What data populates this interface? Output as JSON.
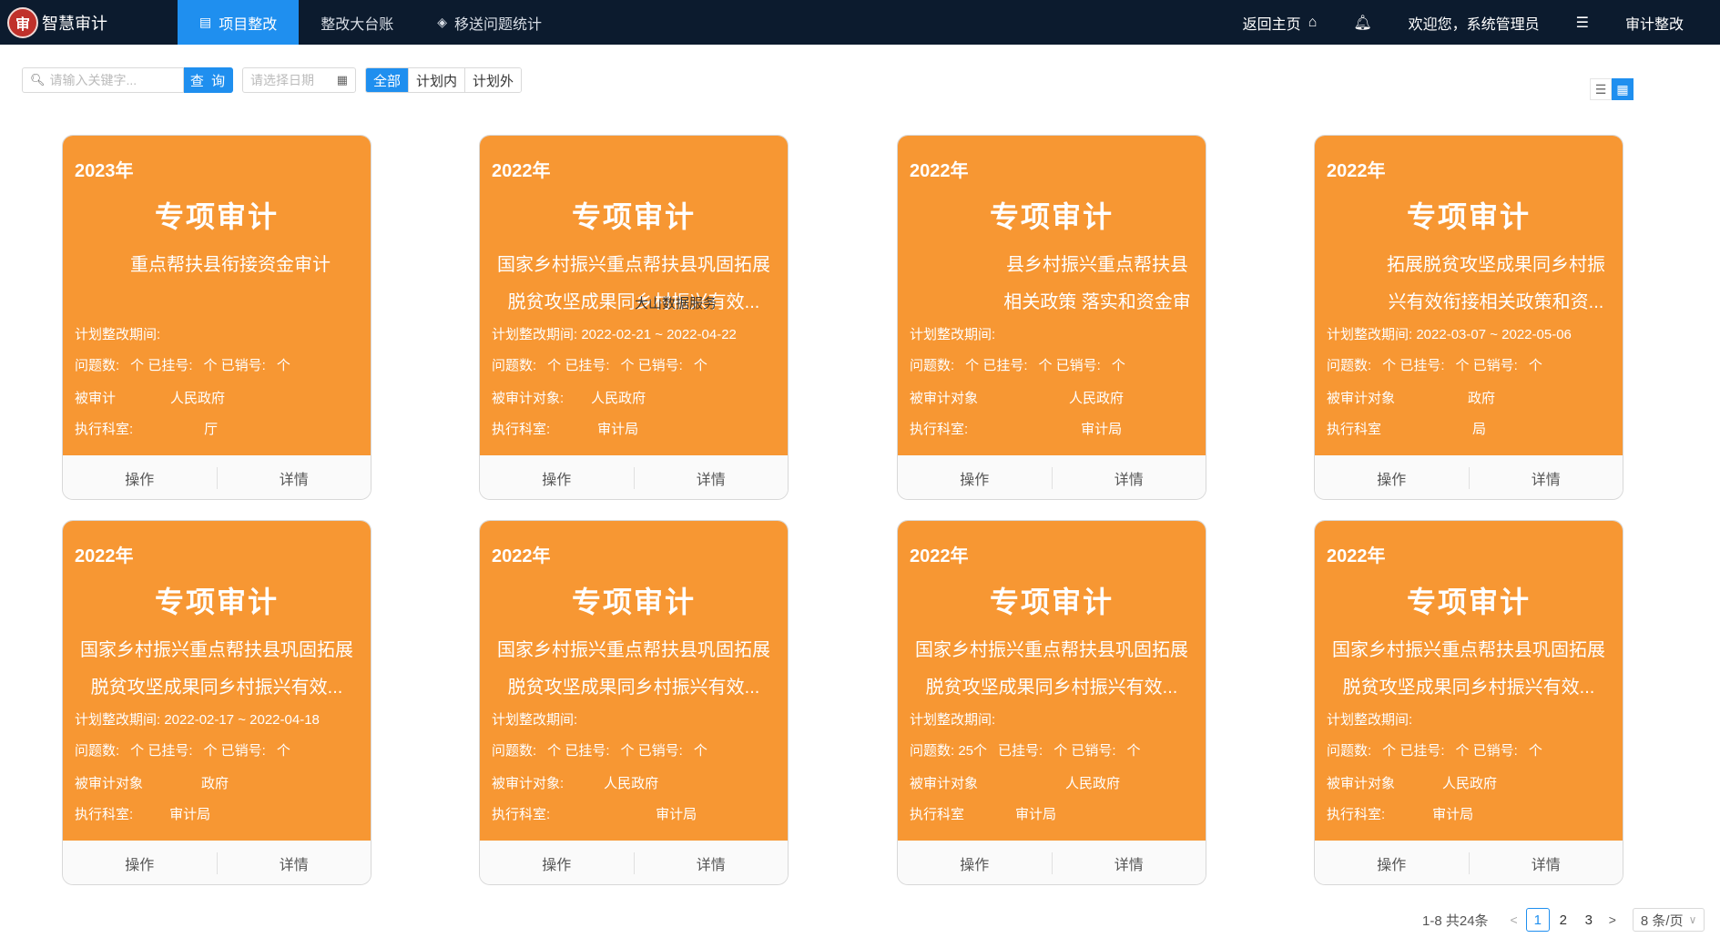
{
  "app": {
    "logo_text": "审",
    "title": "智慧审计"
  },
  "nav": {
    "tabs": [
      {
        "label": "项目整改",
        "icon": "document-icon"
      },
      {
        "label": "整改大台账",
        "icon": ""
      },
      {
        "label": "移送问题统计",
        "icon": "gem-icon"
      }
    ],
    "home_label": "返回主页",
    "welcome": "欢迎您，系统管理员",
    "module": "审计整改"
  },
  "toolbar": {
    "search_placeholder": "请输入关键字...",
    "query_label": "查 询",
    "date_placeholder": "请选择日期",
    "filters": [
      "全部",
      "计划内",
      "计划外"
    ]
  },
  "labels": {
    "operate": "操作",
    "detail": "详情"
  },
  "watermark": "大山数据服务",
  "cards": [
    {
      "year": "2023年",
      "type": "专项审计",
      "name": "重点帮扶县衔接资金审计",
      "period": "计划整改期间:",
      "counts": [
        "问题数:",
        "个 已挂号:",
        "个 已销号:",
        "个"
      ],
      "target": "被审计",
      "target_value": "人民政府",
      "dept": "执行科室:",
      "dept_value": "厅"
    },
    {
      "year": "2022年",
      "type": "专项审计",
      "name": "国家乡村振兴重点帮扶县巩固拓展脱贫攻坚成果同乡村振兴有效...",
      "period": "计划整改期间: 2022-02-21 ~ 2022-04-22",
      "counts": [
        "问题数:",
        "个 已挂号:",
        "个 已销号:",
        "个"
      ],
      "target": "被审计对象:",
      "target_value": "人民政府",
      "dept": "执行科室:",
      "dept_value": "审计局"
    },
    {
      "year": "2022年",
      "type": "专项审计",
      "name": "县乡村振兴重点帮扶县相关政策 落实和资金审计",
      "period": "计划整改期间:",
      "counts": [
        "问题数:",
        "个 已挂号:",
        "个 已销号:",
        "个"
      ],
      "target": "被审计对象",
      "target_value": "人民政府",
      "dept": "执行科室:",
      "dept_value": "审计局"
    },
    {
      "year": "2022年",
      "type": "专项审计",
      "name": "拓展脱贫攻坚成果同乡村振兴有效衔接相关政策和资...",
      "period": "计划整改期间: 2022-03-07 ~ 2022-05-06",
      "counts": [
        "问题数:",
        "个 已挂号:",
        "个 已销号:",
        "个"
      ],
      "target": "被审计对象",
      "target_value": "政府",
      "dept": "执行科室",
      "dept_value": "局"
    },
    {
      "year": "2022年",
      "type": "专项审计",
      "name": "国家乡村振兴重点帮扶县巩固拓展脱贫攻坚成果同乡村振兴有效...",
      "period": "计划整改期间: 2022-02-17 ~ 2022-04-18",
      "counts": [
        "问题数:",
        "个 已挂号:",
        "个 已销号:",
        "个"
      ],
      "target": "被审计对象",
      "target_value": "政府",
      "dept": "执行科室:",
      "dept_value": "审计局"
    },
    {
      "year": "2022年",
      "type": "专项审计",
      "name": "国家乡村振兴重点帮扶县巩固拓展脱贫攻坚成果同乡村振兴有效...",
      "period": "计划整改期间:",
      "counts": [
        "问题数:",
        "个 已挂号:",
        "个 已销号:",
        "个"
      ],
      "target": "被审计对象:",
      "target_value": "人民政府",
      "dept": "执行科室:",
      "dept_value": "审计局"
    },
    {
      "year": "2022年",
      "type": "专项审计",
      "name": "国家乡村振兴重点帮扶县巩固拓展脱贫攻坚成果同乡村振兴有效...",
      "period": "计划整改期间:",
      "counts": [
        "问题数: 25个",
        "已挂号:",
        "个 已销号:",
        "个"
      ],
      "target": "被审计对象",
      "target_value": "人民政府",
      "dept": "执行科室",
      "dept_value": "审计局"
    },
    {
      "year": "2022年",
      "type": "专项审计",
      "name": "国家乡村振兴重点帮扶县巩固拓展脱贫攻坚成果同乡村振兴有效...",
      "period": "计划整改期间:",
      "counts": [
        "问题数:",
        "个 已挂号:",
        "个 已销号:",
        "个"
      ],
      "target": "被审计对象",
      "target_value": "人民政府",
      "dept": "执行科室:",
      "dept_value": "审计局"
    }
  ],
  "pagination": {
    "total": "1-8 共24条",
    "pages": [
      "1",
      "2",
      "3"
    ],
    "size": "8 条/页"
  }
}
